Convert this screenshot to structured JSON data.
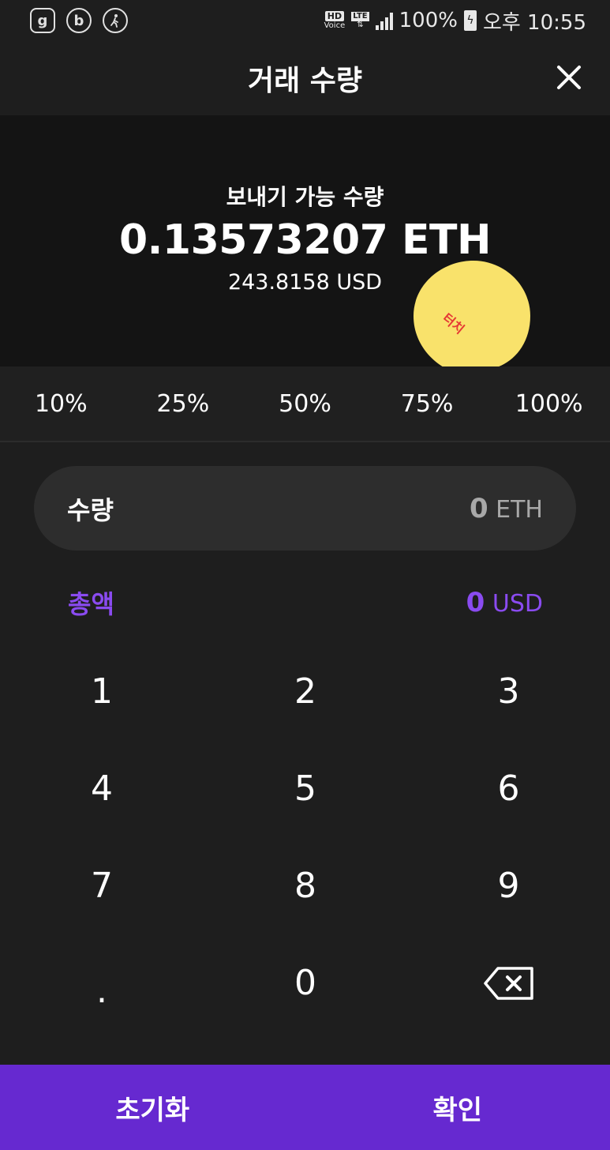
{
  "status_bar": {
    "app_icons": [
      "g-app-icon",
      "b-app-icon",
      "walking-app-icon"
    ],
    "hd_label": "HD",
    "voice_label": "Voice",
    "lte_label": "LTE",
    "battery_percent": "100%",
    "time": "오후 10:55"
  },
  "header": {
    "title": "거래 수량",
    "close_icon": "close-icon"
  },
  "balance": {
    "label": "보내기 가능 수량",
    "amount": "0.13573207 ETH",
    "usd": "243.8158 USD"
  },
  "annotation": {
    "text": "터치",
    "color": "#f9e26b"
  },
  "percent_options": [
    "10%",
    "25%",
    "50%",
    "75%",
    "100%"
  ],
  "quantity": {
    "label": "수량",
    "value": "0",
    "unit": "ETH"
  },
  "total": {
    "label": "총액",
    "value": "0",
    "unit": "USD"
  },
  "keypad": {
    "keys": [
      "1",
      "2",
      "3",
      "4",
      "5",
      "6",
      "7",
      "8",
      "9",
      ".",
      "0"
    ],
    "backspace_icon": "backspace-icon"
  },
  "bottom_buttons": {
    "reset": "초기화",
    "confirm": "확인"
  },
  "colors": {
    "accent_purple": "#6629d0",
    "total_purple": "#8a4bf0",
    "background": "#1e1e1e",
    "balance_bg": "#141414"
  }
}
